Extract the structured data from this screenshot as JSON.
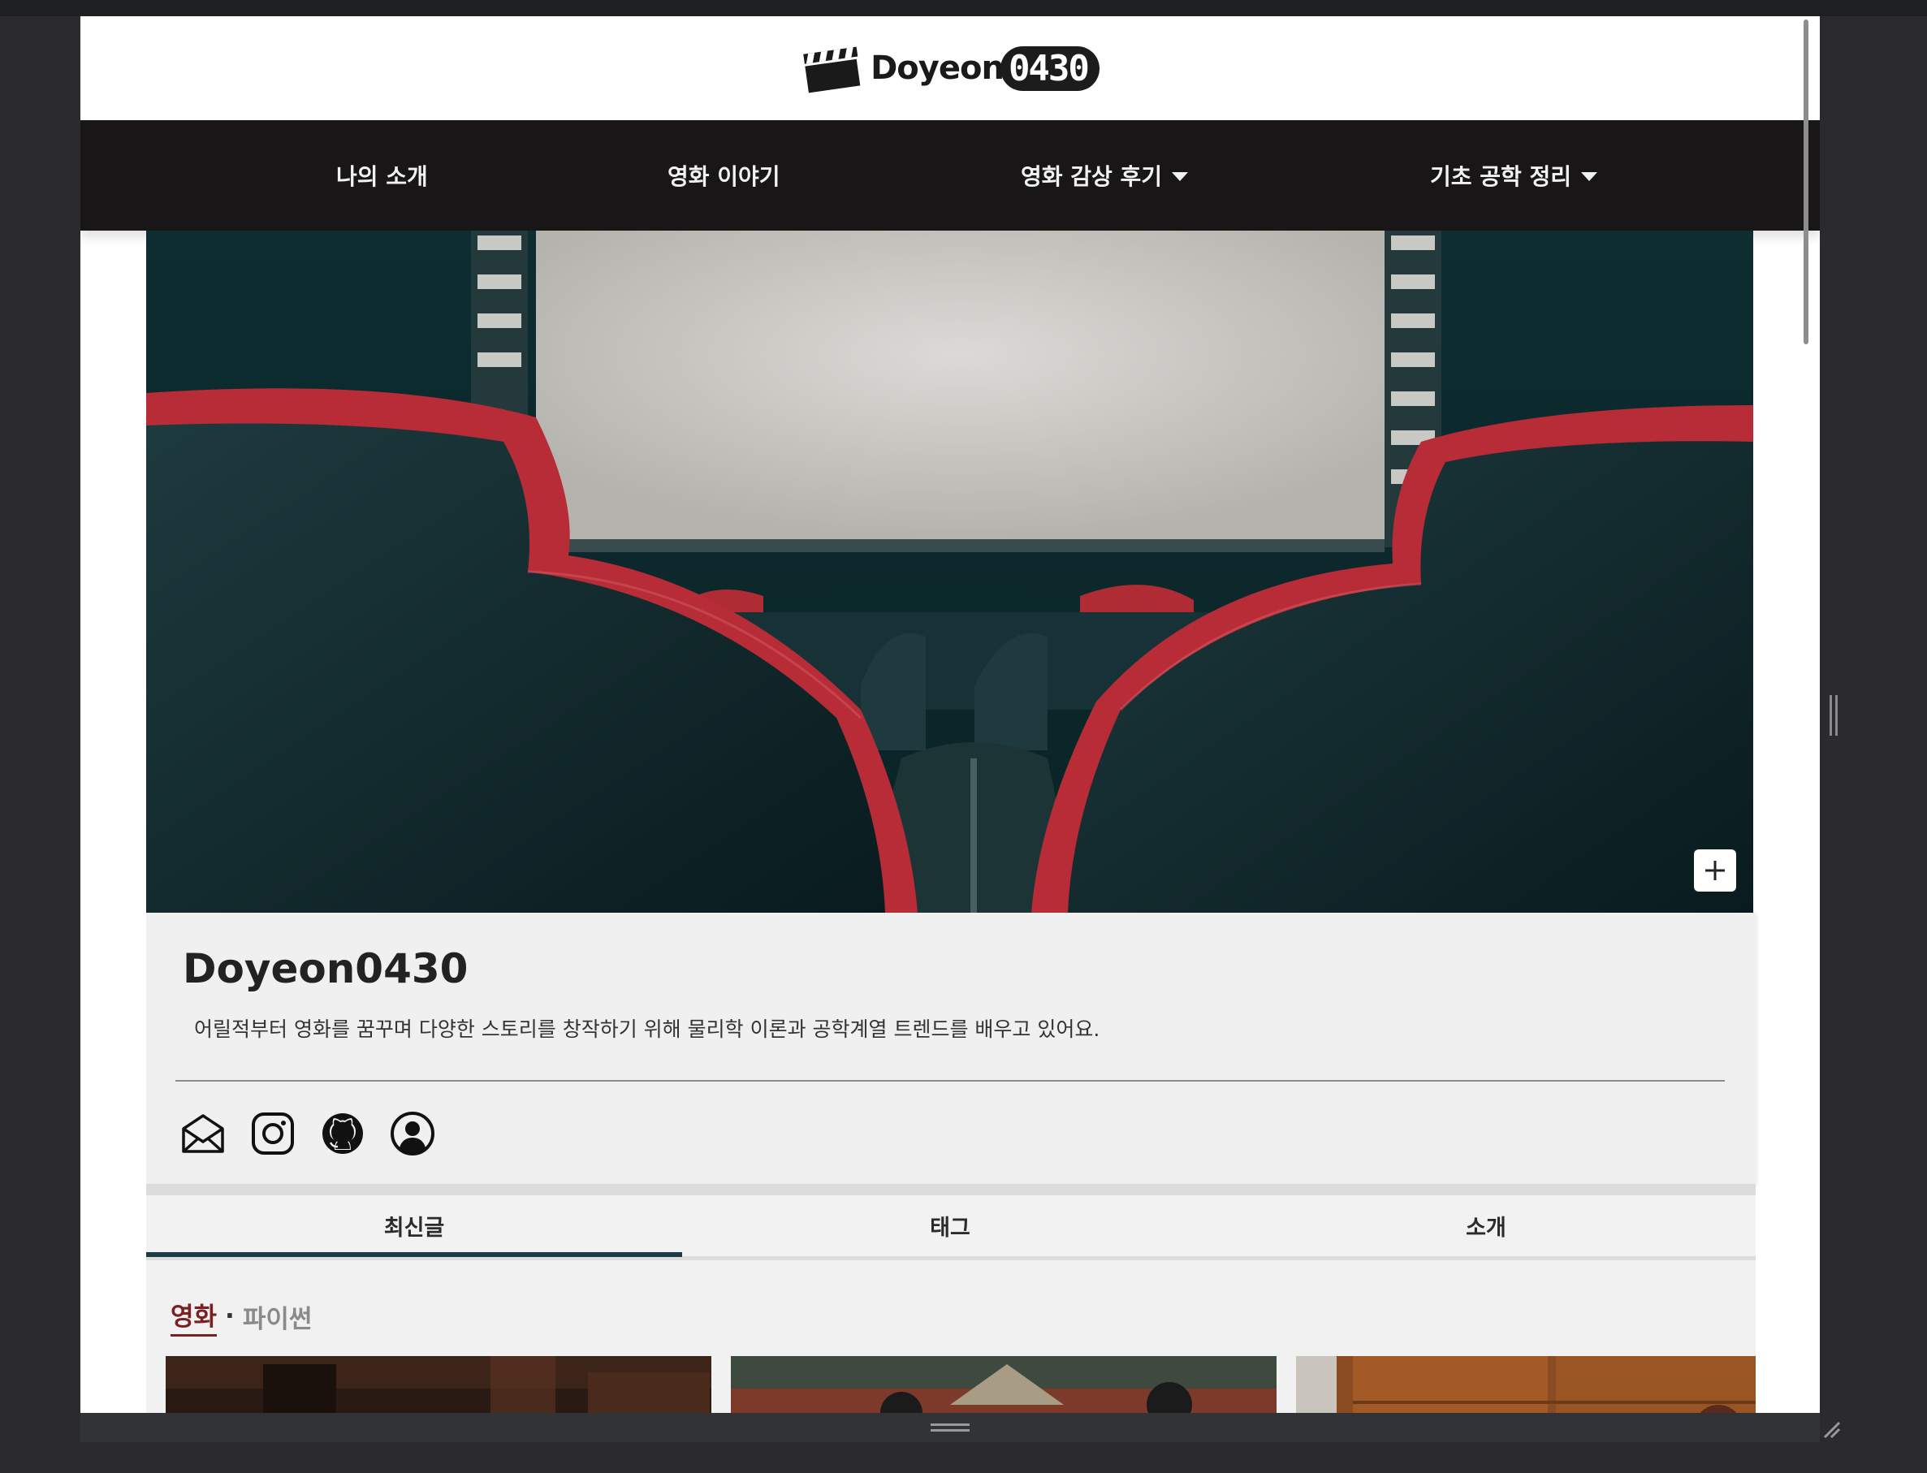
{
  "site": {
    "logo_text": "Doyeon",
    "logo_badge": "0430"
  },
  "nav": {
    "items": [
      {
        "label": "나의 소개",
        "has_dropdown": false
      },
      {
        "label": "영화 이야기",
        "has_dropdown": false
      },
      {
        "label": "영화 감상 후기",
        "has_dropdown": true
      },
      {
        "label": "기초 공학 정리",
        "has_dropdown": true
      }
    ]
  },
  "hero": {
    "image": "cinema-seats-screen",
    "add_button_icon": "plus-icon"
  },
  "profile": {
    "name": "Doyeon0430",
    "description": "어릴적부터 영화를 꿈꾸며 다양한 스토리를 창작하기 위해 물리학 이론과 공학계열 트렌드를 배우고 있어요.",
    "social_icons": [
      "mail-icon",
      "instagram-icon",
      "github-icon",
      "user-icon"
    ]
  },
  "tabs": {
    "items": [
      "최신글",
      "태그",
      "소개"
    ],
    "active": "최신글"
  },
  "filters": {
    "active": "영화",
    "separator": "·",
    "other": "파이썬"
  },
  "colors": {
    "nav_bg": "#181617",
    "accent": "#7a1f22",
    "tab_indicator": "#1e3a44",
    "profile_bg": "#f0f0f0"
  }
}
